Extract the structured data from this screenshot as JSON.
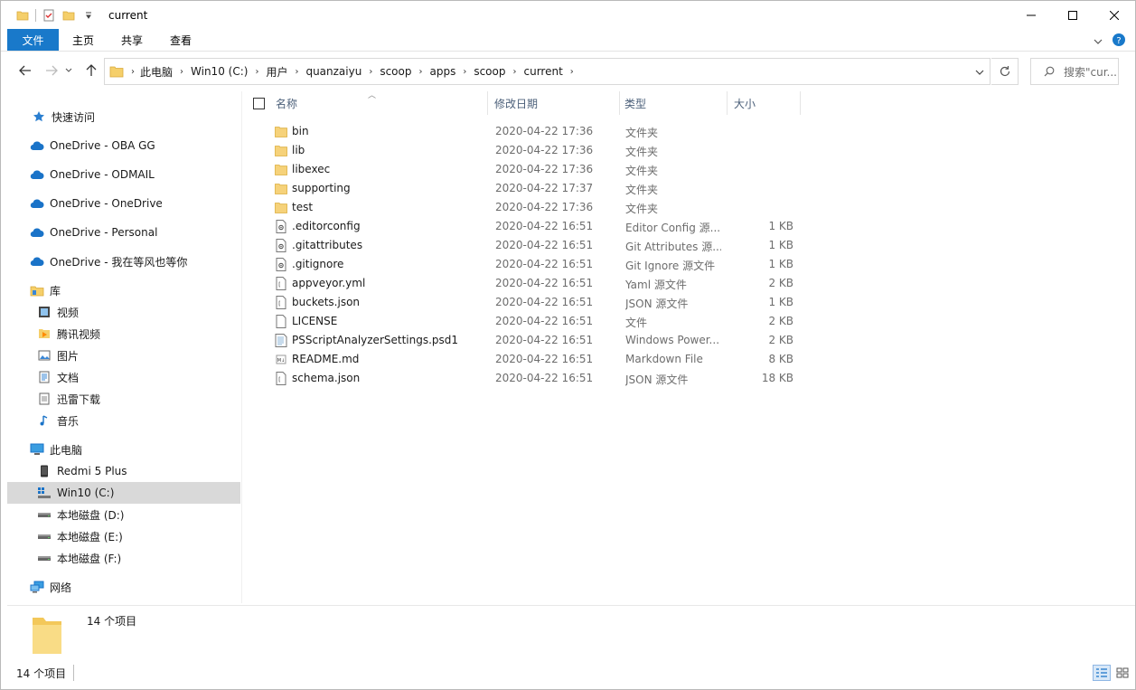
{
  "window": {
    "title": "current",
    "controls": {
      "minimize": "—",
      "maximize": "☐",
      "close": "✕"
    }
  },
  "ribbon": {
    "tabs": [
      "文件",
      "主页",
      "共享",
      "查看"
    ],
    "collapse": "∨",
    "help": "?"
  },
  "address": {
    "crumbs": [
      "此电脑",
      "Win10 (C:)",
      "用户",
      "quanzaiyu",
      "scoop",
      "apps",
      "scoop",
      "current"
    ],
    "search_placeholder": "搜索\"cur..."
  },
  "nav": {
    "items": [
      {
        "label": "快速访问",
        "icon": "star-icon",
        "indent": 0
      },
      {
        "label": "OneDrive - OBA GG",
        "icon": "cloud-icon",
        "indent": 0
      },
      {
        "label": "OneDrive - ODMAIL",
        "icon": "cloud-icon",
        "indent": 0
      },
      {
        "label": "OneDrive - OneDrive",
        "icon": "cloud-icon",
        "indent": 0
      },
      {
        "label": "OneDrive - Personal",
        "icon": "cloud-icon",
        "indent": 0
      },
      {
        "label": "OneDrive - 我在等风也等你",
        "icon": "cloud-icon",
        "indent": 0
      },
      {
        "label": "库",
        "icon": "library-icon",
        "indent": 0
      },
      {
        "label": "视频",
        "icon": "video-icon",
        "indent": 1
      },
      {
        "label": "腾讯视频",
        "icon": "tencent-video-icon",
        "indent": 1
      },
      {
        "label": "图片",
        "icon": "picture-icon",
        "indent": 1
      },
      {
        "label": "文档",
        "icon": "document-icon",
        "indent": 1
      },
      {
        "label": "迅雷下载",
        "icon": "download-icon",
        "indent": 1
      },
      {
        "label": "音乐",
        "icon": "music-icon",
        "indent": 1
      },
      {
        "label": "此电脑",
        "icon": "computer-icon",
        "indent": 0
      },
      {
        "label": "Redmi 5 Plus",
        "icon": "phone-icon",
        "indent": 1
      },
      {
        "label": "Win10 (C:)",
        "icon": "windows-drive-icon",
        "indent": 1,
        "selected": true
      },
      {
        "label": "本地磁盘 (D:)",
        "icon": "drive-icon",
        "indent": 1
      },
      {
        "label": "本地磁盘 (E:)",
        "icon": "drive-icon",
        "indent": 1
      },
      {
        "label": "本地磁盘 (F:)",
        "icon": "drive-icon",
        "indent": 1
      },
      {
        "label": "网络",
        "icon": "network-icon",
        "indent": 0
      }
    ]
  },
  "columns": {
    "name": "名称",
    "date": "修改日期",
    "type": "类型",
    "size": "大小"
  },
  "files": [
    {
      "name": "bin",
      "date": "2020-04-22 17:36",
      "type": "文件夹",
      "size": "",
      "icon": "folder-icon"
    },
    {
      "name": "lib",
      "date": "2020-04-22 17:36",
      "type": "文件夹",
      "size": "",
      "icon": "folder-icon"
    },
    {
      "name": "libexec",
      "date": "2020-04-22 17:36",
      "type": "文件夹",
      "size": "",
      "icon": "folder-icon"
    },
    {
      "name": "supporting",
      "date": "2020-04-22 17:37",
      "type": "文件夹",
      "size": "",
      "icon": "folder-icon"
    },
    {
      "name": "test",
      "date": "2020-04-22 17:36",
      "type": "文件夹",
      "size": "",
      "icon": "folder-icon"
    },
    {
      "name": ".editorconfig",
      "date": "2020-04-22 16:51",
      "type": "Editor Config 源...",
      "size": "1 KB",
      "icon": "config-file-icon"
    },
    {
      "name": ".gitattributes",
      "date": "2020-04-22 16:51",
      "type": "Git Attributes 源...",
      "size": "1 KB",
      "icon": "config-file-icon"
    },
    {
      "name": ".gitignore",
      "date": "2020-04-22 16:51",
      "type": "Git Ignore 源文件",
      "size": "1 KB",
      "icon": "config-file-icon"
    },
    {
      "name": "appveyor.yml",
      "date": "2020-04-22 16:51",
      "type": "Yaml 源文件",
      "size": "2 KB",
      "icon": "source-file-icon"
    },
    {
      "name": "buckets.json",
      "date": "2020-04-22 16:51",
      "type": "JSON 源文件",
      "size": "1 KB",
      "icon": "source-file-icon"
    },
    {
      "name": "LICENSE",
      "date": "2020-04-22 16:51",
      "type": "文件",
      "size": "2 KB",
      "icon": "file-icon"
    },
    {
      "name": "PSScriptAnalyzerSettings.psd1",
      "date": "2020-04-22 16:51",
      "type": "Windows Power...",
      "size": "2 KB",
      "icon": "powershell-file-icon"
    },
    {
      "name": "README.md",
      "date": "2020-04-22 16:51",
      "type": "Markdown File",
      "size": "8 KB",
      "icon": "markdown-file-icon"
    },
    {
      "name": "schema.json",
      "date": "2020-04-22 16:51",
      "type": "JSON 源文件",
      "size": "18 KB",
      "icon": "source-file-icon"
    }
  ],
  "details": {
    "count": "14 个项目"
  },
  "status": {
    "count": "14 个项目"
  }
}
